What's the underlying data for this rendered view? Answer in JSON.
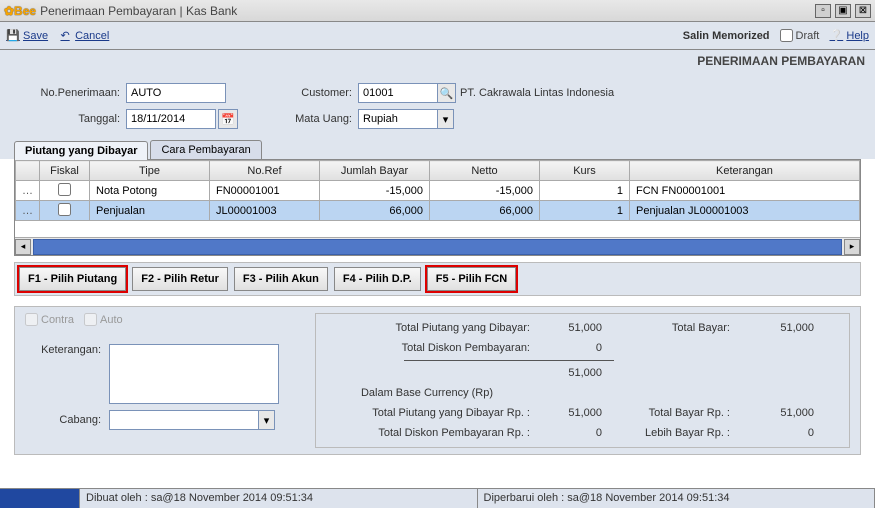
{
  "title": "Penerimaan Pembayaran | Kas Bank",
  "toolbar": {
    "save": "Save",
    "cancel": "Cancel",
    "salin": "Salin Memorized",
    "draft": "Draft",
    "help": "Help"
  },
  "section_title": "PENERIMAAN PEMBAYARAN",
  "form": {
    "no_label": "No.Penerimaan:",
    "no_value": "AUTO",
    "tgl_label": "Tanggal:",
    "tgl_value": "18/11/2014",
    "cust_label": "Customer:",
    "cust_code": "01001",
    "cust_name": "PT. Cakrawala Lintas Indonesia",
    "uang_label": "Mata Uang:",
    "uang_value": "Rupiah"
  },
  "tabs": {
    "t1": "Piutang yang Dibayar",
    "t2": "Cara Pembayaran"
  },
  "grid": {
    "headers": {
      "fiskal": "Fiskal",
      "tipe": "Tipe",
      "noref": "No.Ref",
      "jumlah": "Jumlah Bayar",
      "netto": "Netto",
      "kurs": "Kurs",
      "ket": "Keterangan"
    },
    "rows": [
      {
        "tipe": "Nota Potong",
        "noref": "FN00001001",
        "jumlah": "-15,000",
        "netto": "-15,000",
        "kurs": "1",
        "ket": "FCN FN00001001"
      },
      {
        "tipe": "Penjualan",
        "noref": "JL00001003",
        "jumlah": "66,000",
        "netto": "66,000",
        "kurs": "1",
        "ket": "Penjualan JL00001003"
      }
    ]
  },
  "fkeys": {
    "f1": "F1 - Pilih Piutang",
    "f2": "F2 - Pilih Retur",
    "f3": "F3 - Pilih Akun",
    "f4": "F4 - Pilih D.P.",
    "f5": "F5 - Pilih FCN"
  },
  "left": {
    "contra": "Contra",
    "auto": "Auto",
    "ket_label": "Keterangan:",
    "cabang_label": "Cabang:"
  },
  "totals": {
    "l1": "Total Piutang yang Dibayar:",
    "v1": "51,000",
    "r1": "Total Bayar:",
    "rv1": "51,000",
    "l2": "Total Diskon Pembayaran:",
    "v2": "0",
    "v_sub": "51,000",
    "base": "Dalam Base Currency (Rp)",
    "l3": "Total Piutang yang Dibayar Rp. :",
    "v3": "51,000",
    "r3": "Total Bayar Rp. :",
    "rv3": "51,000",
    "l4": "Total Diskon Pembayaran Rp. :",
    "v4": "0",
    "r4": "Lebih Bayar Rp. :",
    "rv4": "0"
  },
  "status": {
    "s1": "Dibuat oleh : sa@18 November 2014  09:51:34",
    "s2": "Diperbarui oleh : sa@18 November 2014  09:51:34"
  }
}
